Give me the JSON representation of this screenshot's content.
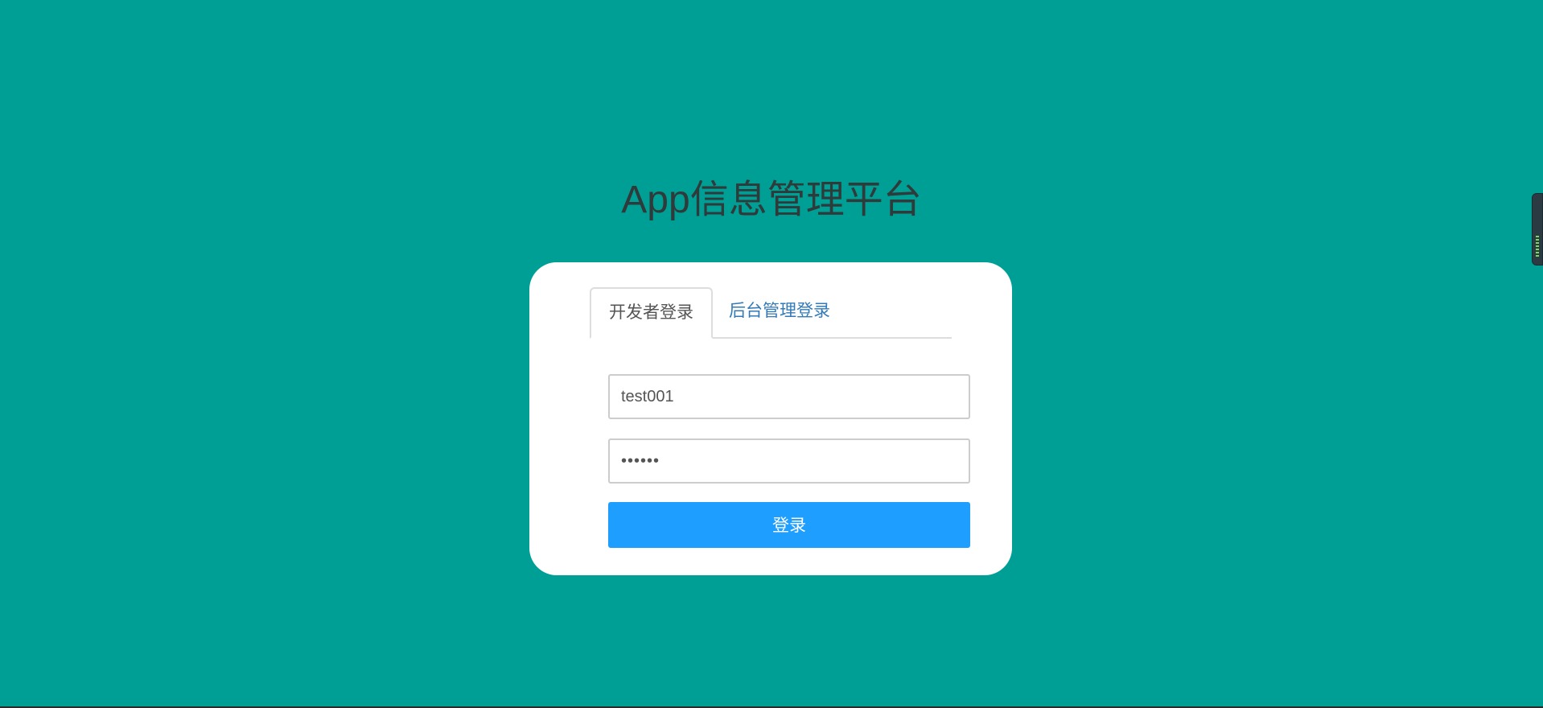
{
  "page": {
    "title": "App信息管理平台",
    "background_color": "#009f95"
  },
  "login": {
    "tabs": [
      {
        "label": "开发者登录",
        "active": true
      },
      {
        "label": "后台管理登录",
        "active": false
      }
    ],
    "username": {
      "value": "test001"
    },
    "password": {
      "value": "••••••"
    },
    "submit_label": "登录",
    "button_color": "#1e9fff",
    "link_color": "#337ab7"
  },
  "side_widget": {
    "icon": "signal-meter-icon"
  }
}
